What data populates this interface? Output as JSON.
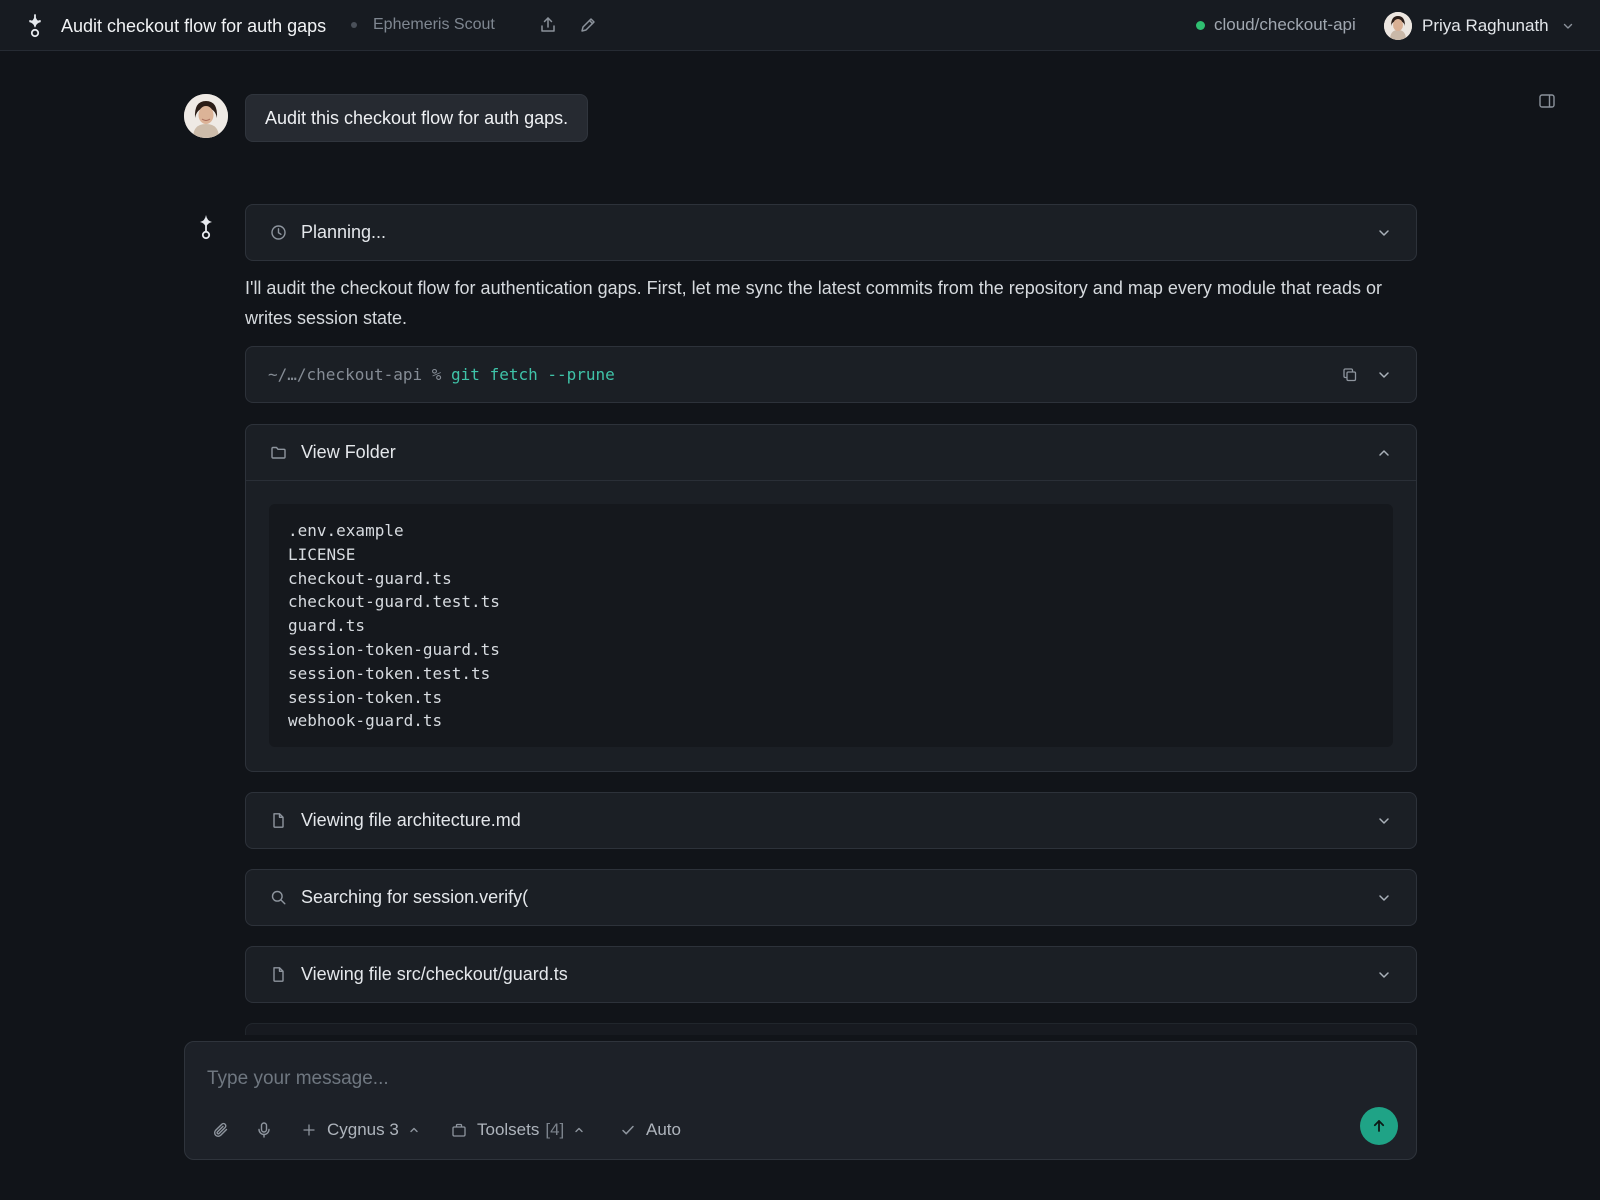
{
  "topbar": {
    "title": "Audit checkout flow for auth gaps",
    "agent_name": "Ephemeris Scout",
    "environment": "cloud/checkout-api",
    "env_status_color": "#2fbf71",
    "user_name": "Priya Raghunath"
  },
  "conversation": {
    "user_message": "Audit this checkout flow for auth gaps.",
    "steps": {
      "planning": {
        "label": "Planning...",
        "icon": "clock-icon",
        "expanded": false
      },
      "assistant_text": "I'll audit the checkout flow for authentication gaps. First, let me sync the latest commits from the repository and map every module that reads or writes session state.",
      "command": {
        "prompt": "~/…/checkout-api %",
        "code": "git fetch --prune",
        "expanded": false
      },
      "view_folder": {
        "label": "View Folder",
        "icon": "folder-icon",
        "expanded": true,
        "files": [
          ".env.example",
          "LICENSE",
          "checkout-guard.ts",
          "checkout-guard.test.ts",
          "guard.ts",
          "session-token-guard.ts",
          "session-token.test.ts",
          "session-token.ts",
          "webhook-guard.ts"
        ]
      },
      "view_architecture": {
        "label": "Viewing file architecture.md",
        "icon": "file-icon",
        "expanded": false
      },
      "search": {
        "label": "Searching for session.verify(",
        "icon": "search-icon",
        "expanded": false
      },
      "view_guard": {
        "label": "Viewing file src/checkout/guard.ts",
        "icon": "file-icon",
        "expanded": false
      }
    }
  },
  "composer": {
    "placeholder": "Type your message...",
    "model": "Cygnus 3",
    "toolsets_label": "Toolsets",
    "toolsets_count": "[4]",
    "mode": "Auto",
    "send_color": "#1fa386"
  }
}
